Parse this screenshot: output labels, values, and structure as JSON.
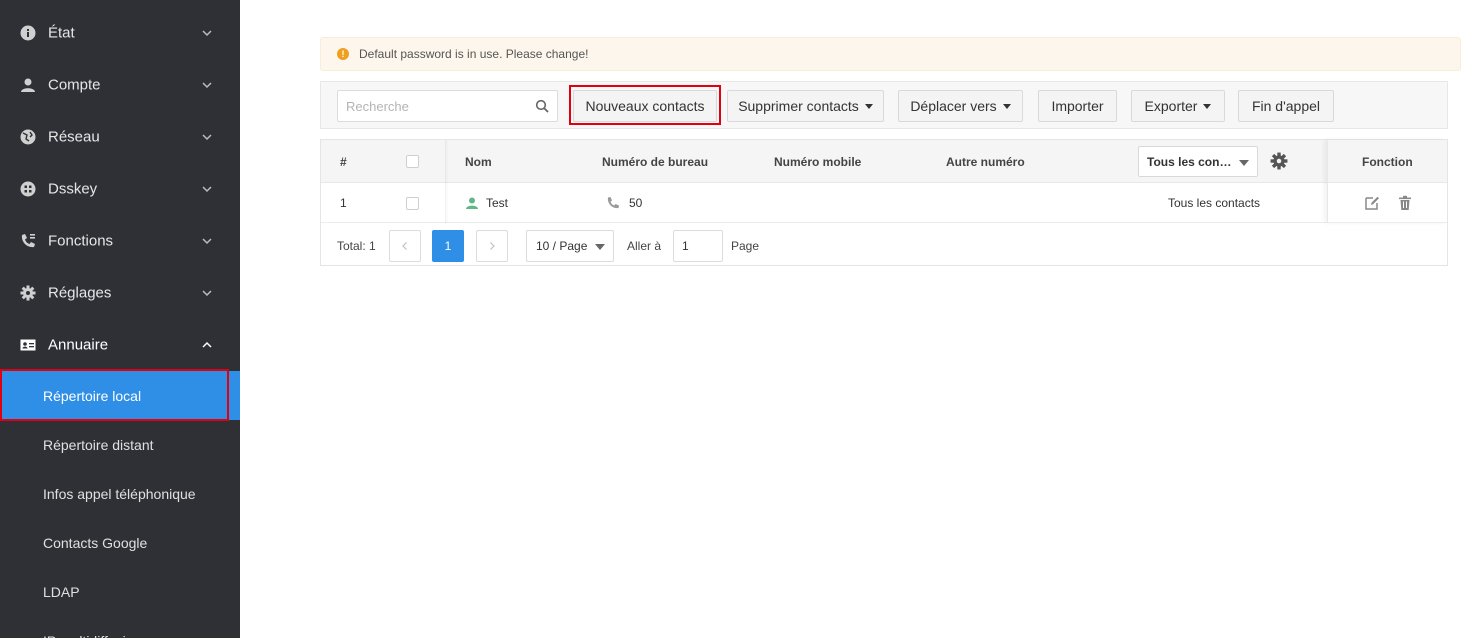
{
  "sidebar": {
    "groups": [
      {
        "label": "État",
        "icon": "info-icon"
      },
      {
        "label": "Compte",
        "icon": "user-icon"
      },
      {
        "label": "Réseau",
        "icon": "globe-icon"
      },
      {
        "label": "Dsskey",
        "icon": "grid-icon"
      },
      {
        "label": "Fonctions",
        "icon": "phone-settings-icon"
      },
      {
        "label": "Réglages",
        "icon": "gear-icon"
      },
      {
        "label": "Annuaire",
        "icon": "contact-card-icon"
      }
    ],
    "sub_items": [
      {
        "label": "Répertoire local"
      },
      {
        "label": "Répertoire distant"
      },
      {
        "label": "Infos appel téléphonique"
      },
      {
        "label": "Contacts Google"
      },
      {
        "label": "LDAP"
      },
      {
        "label": "IP multidiffusion"
      }
    ],
    "active_sub_item": "Répertoire local",
    "highlight_color": "#e0000f",
    "active_color": "#2f8ee6"
  },
  "alert": {
    "text": "Default password is in use. Please change!",
    "icon": "warning-icon"
  },
  "toolbar": {
    "search_placeholder": "Recherche",
    "new_contacts": "Nouveaux contacts",
    "delete_contacts": "Supprimer contacts",
    "move_to": "Déplacer vers",
    "import": "Importer",
    "export": "Exporter",
    "end_call": "Fin d'appel"
  },
  "table": {
    "headers": {
      "index": "#",
      "name": "Nom",
      "office_number": "Numéro de bureau",
      "mobile_number": "Numéro mobile",
      "other_number": "Autre numéro",
      "group_filter": "Tous les con…",
      "function": "Fonction"
    },
    "rows": [
      {
        "index": "1",
        "name": "Test",
        "office_number": "50",
        "mobile_number": "",
        "other_number": "",
        "group": "Tous les contacts"
      }
    ]
  },
  "pagination": {
    "total": "Total: 1",
    "current_page": "1",
    "page_size": "10 / Page",
    "goto_label": "Aller à",
    "goto_value": "1",
    "page_suffix": "Page"
  }
}
